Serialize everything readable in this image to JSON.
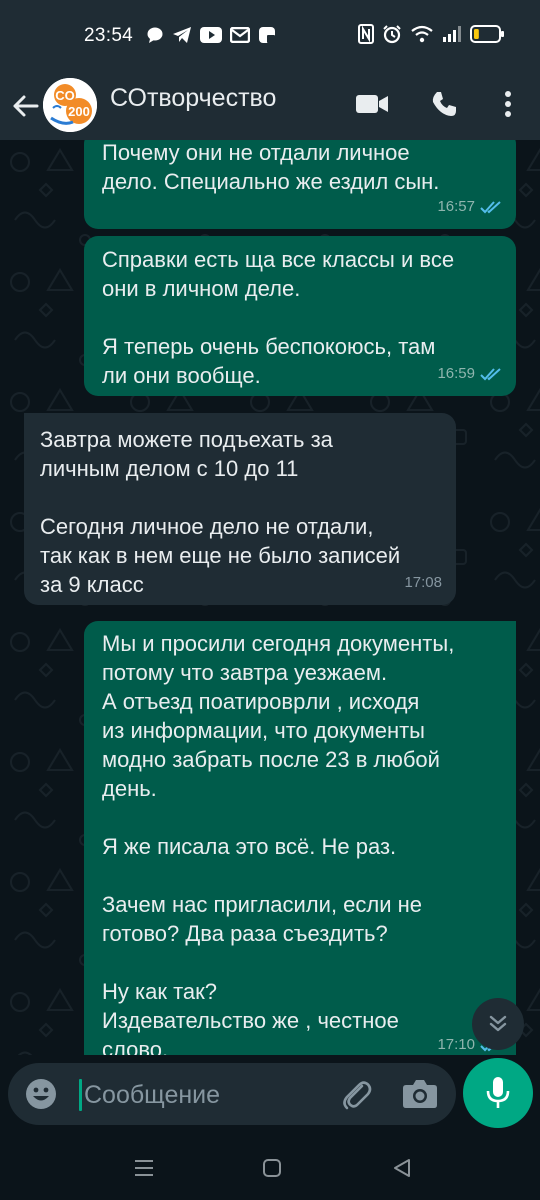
{
  "status_bar": {
    "time": "23:54",
    "left_icons": [
      "chat-notification-icon",
      "telegram-icon",
      "youtube-icon",
      "mail-icon",
      "app-icon"
    ],
    "right_icons": [
      "nfc-icon",
      "alarm-icon",
      "wifi-icon",
      "signal-icon",
      "battery-icon"
    ],
    "battery_level": 0.15
  },
  "app_bar": {
    "title": "СОтворчество",
    "avatar_icon": "school-logo-icon",
    "actions": [
      "video-call-icon",
      "phone-call-icon",
      "more-vert-icon"
    ]
  },
  "messages": [
    {
      "direction": "out",
      "text": "Почему они не отдали личное\nдело. Специально же ездил сын.",
      "time": "16:57",
      "status": "read"
    },
    {
      "direction": "out",
      "text": "Справки есть ща все классы и все\nони в личном деле.\n\nЯ теперь очень беспокоюсь, там\nли они вообще.",
      "time": "16:59",
      "status": "read"
    },
    {
      "direction": "in",
      "text": "Завтра можете подъехать за\nличным делом с 10 до 11\n\nСегодня личное дело не отдали,\nтак как в нем еще не было записей\nза 9 класс",
      "time": "17:08"
    },
    {
      "direction": "out",
      "text": "Мы и просили сегодня документы,\nпотому что завтра уезжаем.\nА отъезд поатировpли , исходя\nиз информации, что документы\nмодно забрать после 23 в любой\nдень.\n\nЯ же писала это всё. Не раз.\n\nЗачем нас пригласили, если не\nготово? Два раза съездить?\n\nНу как так?\nИздевательство же , честное\nслово.",
      "time": "17:10",
      "status": "read"
    }
  ],
  "input": {
    "placeholder": "Сообщение"
  },
  "colors": {
    "outgoing_bubble": "#005c4b",
    "incoming_bubble": "#1f2c34",
    "accent": "#00a884",
    "read_ticks": "#53bdeb",
    "background": "#0b141a"
  }
}
